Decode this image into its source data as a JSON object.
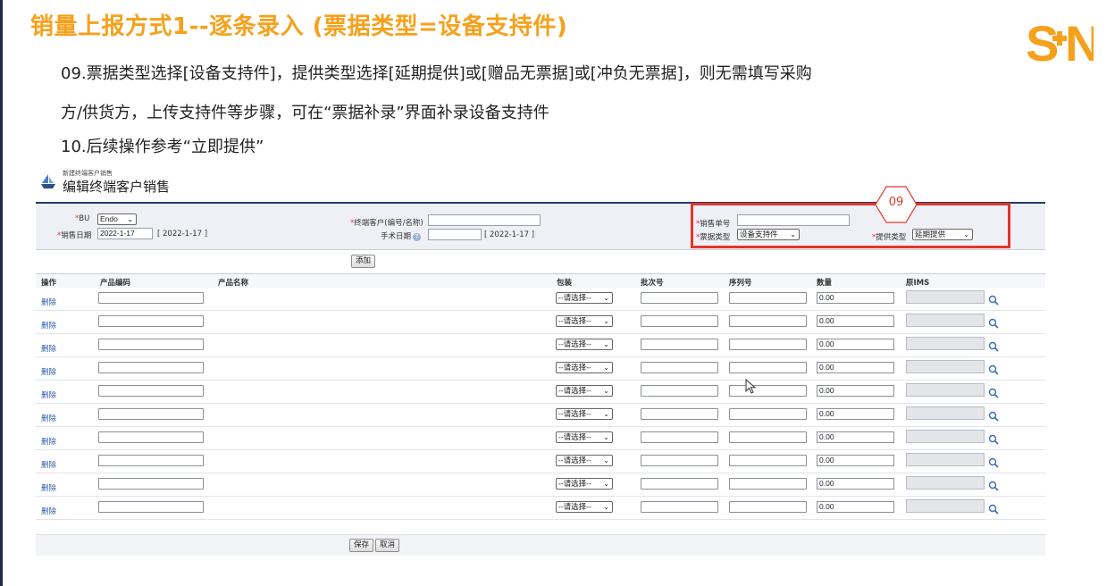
{
  "slide": {
    "title": "销量上报方式1--逐条录入 (票据类型=设备支持件)",
    "logo": "S+N",
    "desc1": "09.票据类型选择[设备支持件]，提供类型选择[延期提供]或[赠品无票据]或[冲负无票据]，则无需填写采购",
    "desc2": "方/供货方，上传支持件等步骤，可在“票据补录”界面补录设备支持件",
    "desc3": "10.后续操作参考“立即提供”",
    "accent_color": "#f5a11c",
    "highlight_color": "#e2362b"
  },
  "app": {
    "breadcrumb": "新建终端客户销售",
    "title": "编辑终端客户销售",
    "icon": "ship-icon"
  },
  "form": {
    "bu_label": "BU",
    "bu_value": "Endo",
    "sale_date_label": "销售日期",
    "sale_date_value": "2022-1-17",
    "sale_date_hint": "[ 2022-1-17 ]",
    "customer_label": "终端客户(编号/名称)",
    "customer_value": "",
    "manual_date_label": "手术日期",
    "manual_date_value": "",
    "manual_date_hint": "[ 2022-1-17 ]",
    "order_label": "销售单号",
    "order_value": "",
    "invoice_type_label": "票据类型",
    "invoice_type_value": "设备支持件",
    "provide_type_label": "提供类型",
    "provide_type_value": "延期提供",
    "badge": "09",
    "add_button": "添加"
  },
  "grid": {
    "headers": [
      "操作",
      "产品编码",
      "产品名称",
      "包装",
      "批次号",
      "序列号",
      "数量",
      "原IMS"
    ],
    "rows": [
      {
        "action": "删除",
        "packaging": "--请选择--",
        "qty": "0.00"
      },
      {
        "action": "删除",
        "packaging": "--请选择--",
        "qty": "0.00"
      },
      {
        "action": "删除",
        "packaging": "--请选择--",
        "qty": "0.00"
      },
      {
        "action": "删除",
        "packaging": "--请选择--",
        "qty": "0.00"
      },
      {
        "action": "删除",
        "packaging": "--请选择--",
        "qty": "0.00"
      },
      {
        "action": "删除",
        "packaging": "--请选择--",
        "qty": "0.00"
      },
      {
        "action": "删除",
        "packaging": "--请选择--",
        "qty": "0.00"
      },
      {
        "action": "删除",
        "packaging": "--请选择--",
        "qty": "0.00"
      },
      {
        "action": "删除",
        "packaging": "--请选择--",
        "qty": "0.00"
      },
      {
        "action": "删除",
        "packaging": "--请选择--",
        "qty": "0.00"
      }
    ]
  },
  "footer": {
    "save": "保存",
    "cancel": "取消"
  }
}
